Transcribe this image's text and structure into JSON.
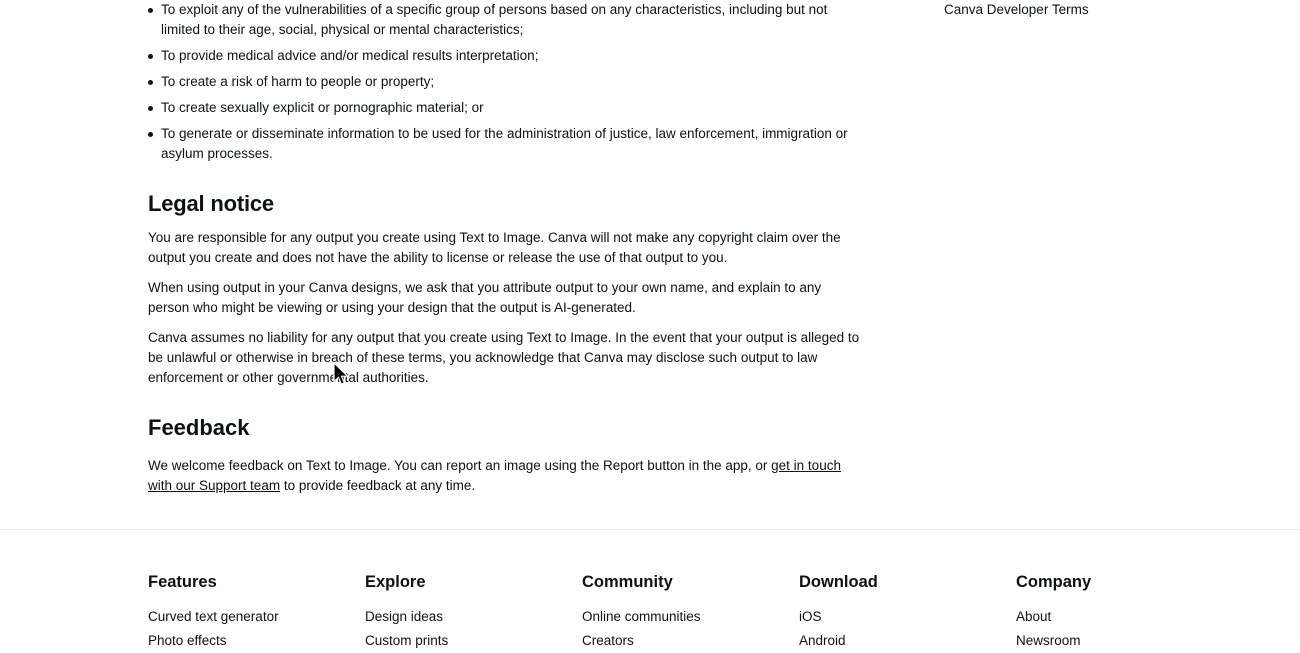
{
  "document": {
    "bullets": [
      "To exploit any of the vulnerabilities of a specific group of persons based on any characteristics, including but not limited to their age, social, physical or mental characteristics;",
      "To provide medical advice and/or medical results interpretation;",
      "To create a risk of harm to people or property;",
      "To create sexually explicit or pornographic material; or",
      "To generate or disseminate information to be used for the administration of justice, law enforcement, immigration or asylum processes."
    ],
    "legal_notice": {
      "heading": "Legal notice",
      "paragraphs": [
        "You are responsible for any output you create using Text to Image. Canva will not make any copyright claim over the output you create and does not have the ability to license or release the use of that output to you.",
        "When using output in your Canva designs, we ask that you attribute output to your own name, and explain to any person who might be viewing or using your design that the output is AI-generated.",
        "Canva assumes no liability for any output that you create using Text to Image. In the event that your output is alleged to be unlawful or otherwise in breach of these terms, you acknowledge that Canva may disclose such output to law enforcement or other governmental authorities."
      ]
    },
    "feedback": {
      "heading": "Feedback",
      "text_before_link": "We welcome feedback on Text to Image. You can report an image using the Report button in the app, or ",
      "link_text": "get in touch with our Support team",
      "text_after_link": " to provide feedback at any time."
    },
    "side_link": {
      "label": "Canva Developer Terms"
    },
    "cursor": {
      "name": "mouse-pointer"
    }
  },
  "footer": {
    "columns": [
      {
        "heading": "Features",
        "items": [
          "Curved text generator",
          "Photo effects"
        ]
      },
      {
        "heading": "Explore",
        "items": [
          "Design ideas",
          "Custom prints"
        ]
      },
      {
        "heading": "Community",
        "items": [
          "Online communities",
          "Creators"
        ]
      },
      {
        "heading": "Download",
        "items": [
          "iOS",
          "Android"
        ]
      },
      {
        "heading": "Company",
        "items": [
          "About",
          "Newsroom"
        ]
      }
    ]
  }
}
